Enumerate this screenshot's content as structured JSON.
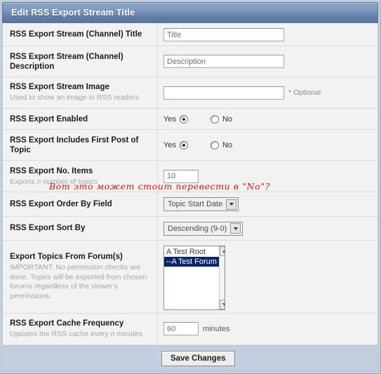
{
  "header": {
    "title": "Edit RSS Export Stream Title"
  },
  "rows": [
    {
      "label": "RSS Export Stream (Channel) Title",
      "description": "",
      "field_value": "Title"
    },
    {
      "label": "RSS Export Stream (Channel) Description",
      "description": "",
      "field_value": "Description"
    },
    {
      "label": "RSS Export Stream Image",
      "description": "Used to show an image in RSS readers",
      "field_value": "",
      "hint": "* Optional"
    },
    {
      "label": "RSS Export Enabled",
      "description": "",
      "yes_label": "Yes",
      "no_label": "No",
      "selected": "Yes"
    },
    {
      "label": "RSS Export Includes First Post of Topic",
      "description": "",
      "yes_label": "Yes",
      "no_label": "No",
      "selected": "Yes"
    },
    {
      "label": "RSS Export No. Items",
      "description_pre": "Exports ",
      "description_italic": "n",
      "description_post": " number of topics",
      "field_value": "10"
    },
    {
      "label": "RSS Export Order By Field",
      "description": "",
      "select_value": "Topic Start Date"
    },
    {
      "label": "RSS Export Sort By",
      "description": "",
      "select_value": "Descending (9-0)"
    },
    {
      "label": "Export Topics From Forum(s)",
      "description": "IMPORTANT: No permission checks are done. Topics will be exported from chosen forums regardless of the viewer's permissions.",
      "list_options": [
        {
          "label": "A Test Root",
          "selected": false
        },
        {
          "label": "--A Test Forum",
          "selected": true
        }
      ]
    },
    {
      "label": "RSS Export Cache Frequency",
      "description_pre": "Updates the RSS cache every ",
      "description_italic": "n",
      "description_post": " minutes",
      "field_value": "60",
      "suffix": "minutes"
    }
  ],
  "annotation": {
    "text": "Вот это может стоит перевести в \"No\"?",
    "color": "#cc1414"
  },
  "footer": {
    "save_label": "Save Changes"
  },
  "colors": {
    "titlebar_start": "#8ca6c8",
    "titlebar_end": "#5a76a0",
    "panel_bg": "#c3cfdf",
    "row_bg": "#f2f2f2",
    "list_selected": "#0a246a"
  }
}
